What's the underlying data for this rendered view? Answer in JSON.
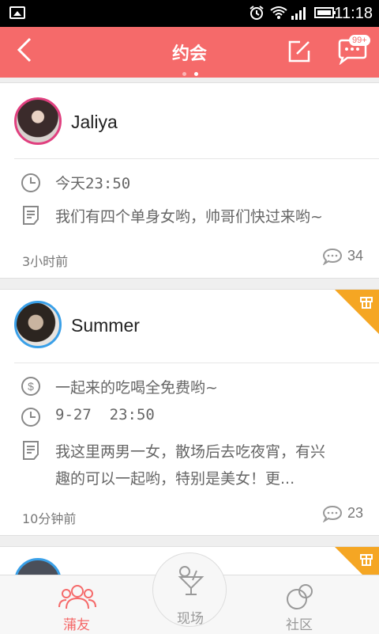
{
  "status_bar": {
    "time": "11:18"
  },
  "header": {
    "title": "约会",
    "message_badge": "99+",
    "page_dots": 2,
    "active_dot": 1
  },
  "posts": [
    {
      "username": "Jaliya",
      "time_row": "今天23:50",
      "description": "我们有四个单身女哟，帅哥们快过来哟~",
      "posted": "3小时前",
      "comments": "34",
      "avatar_border": "#e0407f",
      "rewarded": false
    },
    {
      "username": "Summer",
      "money_row": "一起来的吃喝全免费哟~",
      "time_row": "9-27  23:50",
      "description_line1": "我这里两男一女，散场后去吃夜宵，有兴",
      "description_line2": "趣的可以一起哟，特别是美女！更...",
      "posted": "10分钟前",
      "comments": "23",
      "avatar_border": "#3aa0e8",
      "rewarded": true
    }
  ],
  "tabs": [
    {
      "label": "蒲友",
      "active": true
    },
    {
      "label": "现场",
      "active": false
    },
    {
      "label": "社区",
      "active": false
    }
  ],
  "colors": {
    "brand": "#f56a6a",
    "reward": "#f5a623",
    "text_secondary": "#666666"
  }
}
